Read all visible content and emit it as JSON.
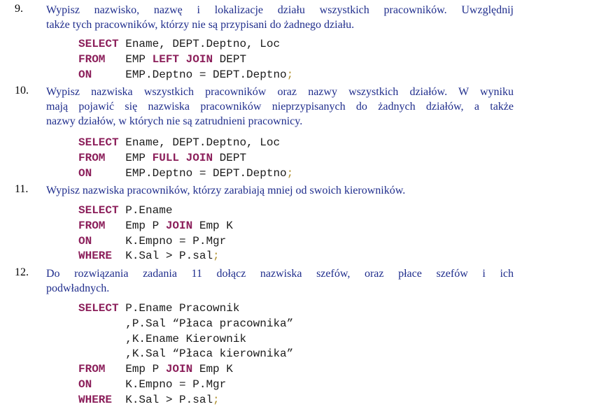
{
  "tasks": [
    {
      "num": "9.",
      "text_lines": [
        "Wypisz nazwisko, nazwę i lokalizacje działu wszystkich pracowników. Uwzględnij",
        "także tych pracowników, którzy nie są przypisani do żadnego działu."
      ],
      "code_lines": [
        {
          "kw": "SELECT",
          "pad": " ",
          "kw2": "",
          "rest": "Ename, DEPT.Deptno, Loc",
          "semi": ""
        },
        {
          "kw": "FROM",
          "pad": "   ",
          "pre": "EMP ",
          "kw2": "LEFT JOIN",
          "rest": " DEPT",
          "semi": ""
        },
        {
          "kw": "ON",
          "pad": "     ",
          "kw2": "",
          "rest": "EMP.Deptno = DEPT.Deptno",
          "semi": ";"
        }
      ]
    },
    {
      "num": "10.",
      "text_lines": [
        "Wypisz nazwiska wszystkich pracowników oraz nazwy wszystkich działów. W wyniku",
        "mają pojawić się nazwiska pracowników nieprzypisanych do żadnych działów, a także",
        "nazwy działów, w których nie są zatrudnieni pracownicy."
      ],
      "code_lines": [
        {
          "kw": "SELECT",
          "pad": " ",
          "kw2": "",
          "rest": "Ename, DEPT.Deptno, Loc",
          "semi": ""
        },
        {
          "kw": "FROM",
          "pad": "   ",
          "pre": "EMP ",
          "kw2": "FULL JOIN",
          "rest": " DEPT",
          "semi": ""
        },
        {
          "kw": "ON",
          "pad": "     ",
          "kw2": "",
          "rest": "EMP.Deptno = DEPT.Deptno",
          "semi": ";"
        }
      ]
    },
    {
      "num": "11.",
      "text_lines": [
        "Wypisz nazwiska pracowników, którzy zarabiają mniej od swoich kierowników."
      ],
      "code_lines": [
        {
          "kw": "SELECT",
          "pad": " ",
          "kw2": "",
          "rest": "P.Ename",
          "semi": ""
        },
        {
          "kw": "FROM",
          "pad": "   ",
          "pre": "Emp P ",
          "kw2": "JOIN",
          "rest": " Emp K",
          "semi": ""
        },
        {
          "kw": "ON",
          "pad": "     ",
          "kw2": "",
          "rest": "K.Empno = P.Mgr",
          "semi": ""
        },
        {
          "kw": "WHERE",
          "pad": "  ",
          "kw2": "",
          "rest": "K.Sal > P.sal",
          "semi": ";"
        }
      ]
    },
    {
      "num": "12.",
      "text_lines": [
        "Do rozwiązania zadania 11 dołącz nazwiska szefów, oraz płace szefów i ich",
        "podwładnych."
      ],
      "code_lines": [
        {
          "kw": "SELECT",
          "pad": " ",
          "kw2": "",
          "rest": "P.Ename Pracownik",
          "semi": ""
        },
        {
          "kw": "",
          "pad": "       ",
          "kw2": "",
          "rest": ",P.Sal “Płaca pracownika”",
          "semi": ""
        },
        {
          "kw": "",
          "pad": "       ",
          "kw2": "",
          "rest": ",K.Ename Kierownik",
          "semi": ""
        },
        {
          "kw": "",
          "pad": "       ",
          "kw2": "",
          "rest": ",K.Sal “Płaca kierownika”",
          "semi": ""
        },
        {
          "kw": "FROM",
          "pad": "   ",
          "pre": "Emp P ",
          "kw2": "JOIN",
          "rest": " Emp K",
          "semi": ""
        },
        {
          "kw": "ON",
          "pad": "     ",
          "kw2": "",
          "rest": "K.Empno = P.Mgr",
          "semi": ""
        },
        {
          "kw": "WHERE",
          "pad": "  ",
          "kw2": "",
          "rest": "K.Sal > P.sal",
          "semi": ";"
        }
      ]
    }
  ]
}
